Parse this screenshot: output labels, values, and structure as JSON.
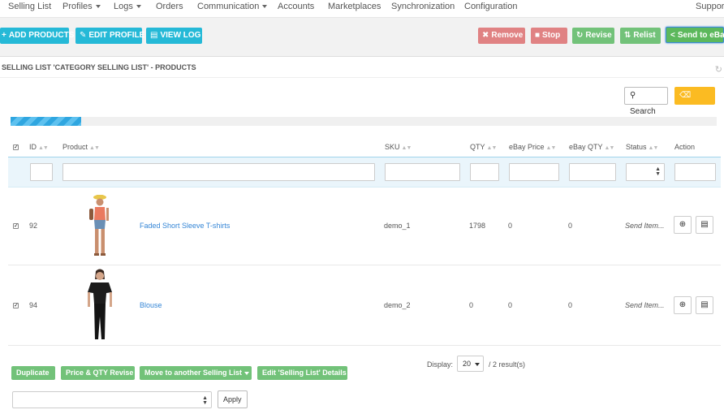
{
  "nav": {
    "items": [
      {
        "label": "Selling List",
        "caret": false
      },
      {
        "label": "Profiles",
        "caret": true
      },
      {
        "label": "Logs",
        "caret": true
      },
      {
        "label": "Orders",
        "caret": false
      },
      {
        "label": "Communication",
        "caret": true
      },
      {
        "label": "Accounts",
        "caret": false
      },
      {
        "label": "Marketplaces",
        "caret": false
      },
      {
        "label": "Synchronization",
        "caret": false
      },
      {
        "label": "Configuration",
        "caret": false
      },
      {
        "label": "Support",
        "caret": false
      }
    ]
  },
  "toolbar": {
    "add_products": "ADD PRODUCTS",
    "edit_profile": "EDIT PROFILE",
    "view_log": "VIEW LOG",
    "remove": "Remove",
    "stop": "Stop",
    "revise": "Revise",
    "relist": "Relist",
    "send_to_ebay": "Send to eBay"
  },
  "panel": {
    "title": "SELLING LIST 'CATEGORY SELLING LIST' - PRODUCTS",
    "search": "Search",
    "reset": "Reset",
    "progress_fraction": 0.1
  },
  "table": {
    "headers": {
      "id": "ID",
      "product": "Product",
      "sku": "SKU",
      "qty": "QTY",
      "ebay_price": "eBay Price",
      "ebay_qty": "eBay QTY",
      "status": "Status",
      "action": "Action"
    },
    "rows": [
      {
        "id": "92",
        "product": "Faded Short Sleeve T-shirts",
        "sku": "demo_1",
        "qty": "1798",
        "ebay_price": "0",
        "ebay_qty": "0",
        "status": "Send Item..."
      },
      {
        "id": "94",
        "product": "Blouse",
        "sku": "demo_2",
        "qty": "0",
        "ebay_price": "0",
        "ebay_qty": "0",
        "status": "Send Item..."
      }
    ]
  },
  "footer": {
    "duplicate": "Duplicate",
    "price_qty_revise": "Price & QTY Revise",
    "move_to_list": "Move to another Selling List",
    "edit_details": "Edit 'Selling List' Details",
    "display_label": "Display:",
    "display_value": "20",
    "results": "/ 2 result(s)",
    "apply": "Apply"
  },
  "colors": {
    "blue_button": "#25b9d7",
    "red_button": "#e08283",
    "green_button": "#72c279",
    "reset_button": "#fbbb22",
    "link": "#3586d6"
  }
}
